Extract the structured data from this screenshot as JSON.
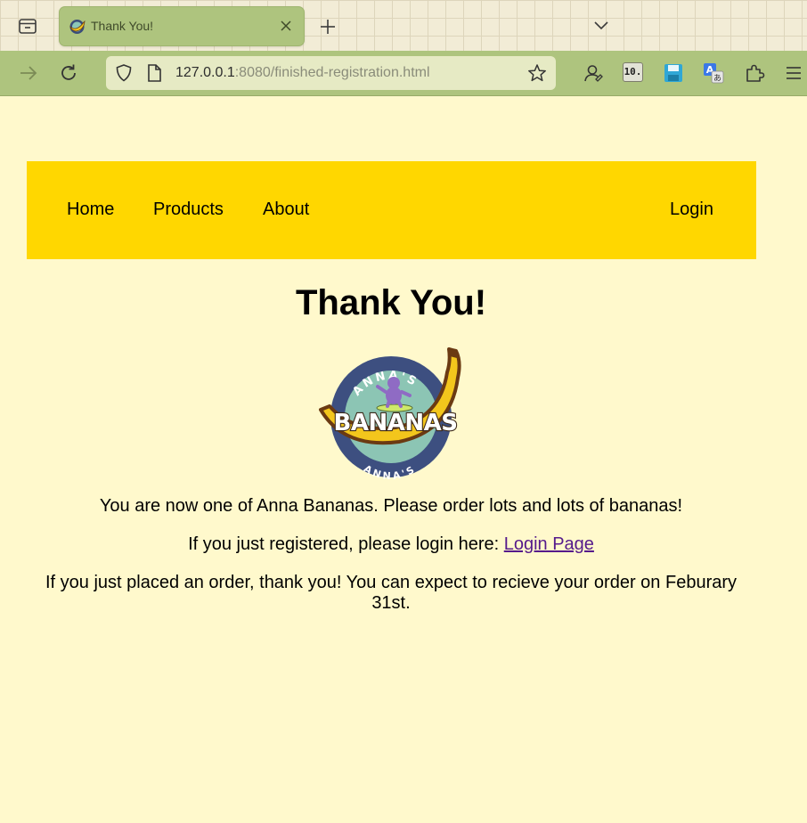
{
  "browser": {
    "tab": {
      "title": "Thank You!",
      "favicon": "annas-bananas-favicon"
    },
    "url": {
      "host": "127.0.0.1",
      "rest": ":8080/finished-registration.html"
    },
    "icons": [
      "tab-list-icon",
      "close-icon",
      "plus-icon",
      "chevron-down-icon",
      "forward-arrow-icon",
      "reload-icon",
      "shield-icon",
      "page-icon",
      "star-icon",
      "account-icon",
      "extension-10-badge",
      "save-disk-icon",
      "translate-icon",
      "puzzle-icon",
      "hamburger-menu-icon"
    ],
    "extension_badge": "10."
  },
  "colors": {
    "page_bg": "#fff9cc",
    "nav_bg": "#ffd700",
    "browser_accent": "#aec47e",
    "link_visited": "#551a8b"
  },
  "site_nav": {
    "home": "Home",
    "products": "Products",
    "about": "About",
    "login": "Login"
  },
  "main": {
    "title": "Thank You!",
    "logo": {
      "top_text": "ANNA'S",
      "main_text": "BANANAS",
      "bottom_text": "ANNA'S"
    },
    "message1": "You are now one of Anna Bananas. Please order lots and lots of bananas!",
    "message2_prefix": "If you just registered, please login here:",
    "login_link": "Login Page",
    "message3": "If you just placed an order, thank you! You can expect to recieve your order on Feburary 31st."
  }
}
